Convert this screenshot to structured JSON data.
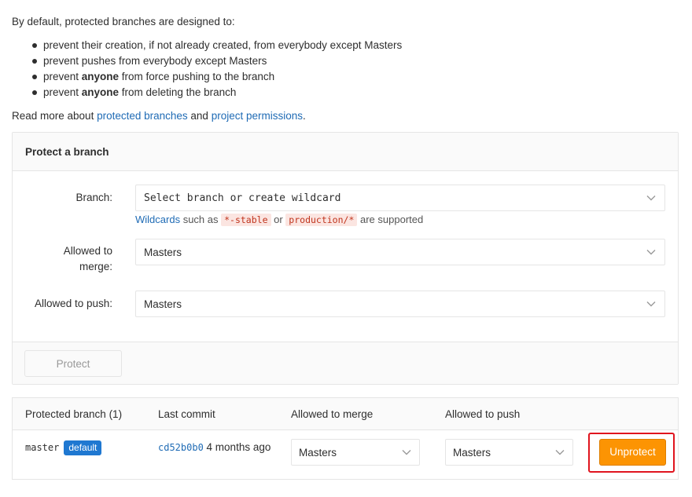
{
  "intro": {
    "lead": "By default, protected branches are designed to:",
    "bullets": [
      {
        "pre": "prevent their creation, if not already created, from everybody except Masters",
        "bold": "",
        "post": ""
      },
      {
        "pre": "prevent pushes from everybody except Masters",
        "bold": "",
        "post": ""
      },
      {
        "pre": "prevent ",
        "bold": "anyone",
        "post": " from force pushing to the branch"
      },
      {
        "pre": "prevent ",
        "bold": "anyone",
        "post": " from deleting the branch"
      }
    ],
    "read_more_pre": "Read more about ",
    "link_branches": "protected branches",
    "read_more_mid": " and ",
    "link_permissions": "project permissions",
    "read_more_post": "."
  },
  "protect_panel": {
    "title": "Protect a branch",
    "branch_label": "Branch:",
    "branch_placeholder": "Select branch or create wildcard",
    "hint_link": "Wildcards",
    "hint_text1": " such as ",
    "hint_code1": "*-stable",
    "hint_text2": " or ",
    "hint_code2": "production/*",
    "hint_text3": " are supported",
    "merge_label_line1": "Allowed to",
    "merge_label_line2": "merge:",
    "merge_value": "Masters",
    "push_label": "Allowed to push:",
    "push_value": "Masters",
    "protect_button": "Protect"
  },
  "table": {
    "headers": {
      "branch": "Protected branch (1)",
      "commit": "Last commit",
      "merge": "Allowed to merge",
      "push": "Allowed to push"
    },
    "rows": [
      {
        "branch": "master",
        "badge": "default",
        "commit_sha": "cd52b0b0",
        "commit_time": " 4 months ago",
        "merge": "Masters",
        "push": "Masters",
        "action": "Unprotect"
      }
    ]
  },
  "colors": {
    "link": "#1f6bb5",
    "badge": "#1f78d1",
    "unprotect": "#fc9403",
    "highlight": "#e0141e"
  }
}
